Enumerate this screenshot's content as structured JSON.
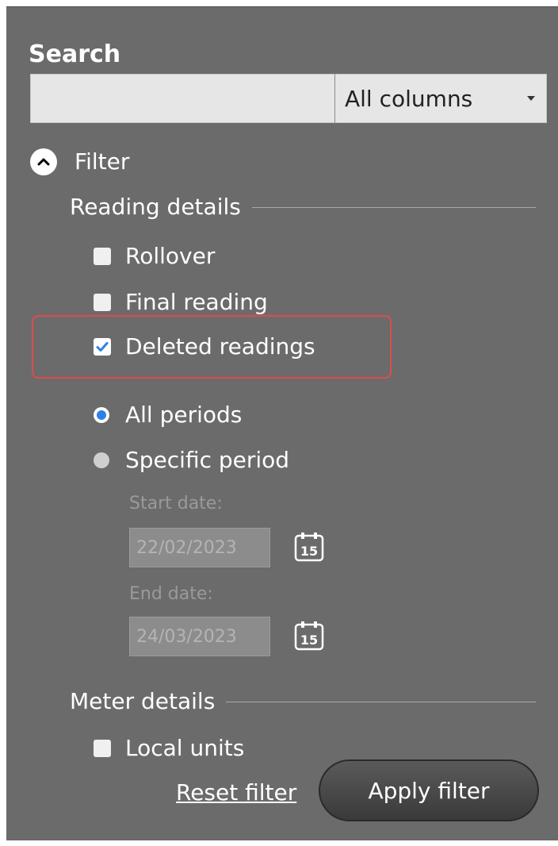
{
  "search": {
    "title": "Search",
    "input_value": "",
    "scope_selected": "All columns"
  },
  "filter": {
    "toggle_label": "Filter",
    "reading_details": {
      "header": "Reading details",
      "checkboxes": [
        {
          "label": "Rollover",
          "checked": false
        },
        {
          "label": "Final reading",
          "checked": false
        },
        {
          "label": "Deleted readings",
          "checked": true
        }
      ],
      "periods": [
        {
          "label": "All periods",
          "selected": true
        },
        {
          "label": "Specific period",
          "selected": false
        }
      ],
      "start_date_label": "Start date:",
      "start_date_value": "22/02/2023",
      "end_date_label": "End date:",
      "end_date_value": "24/03/2023",
      "calendar_day": "15"
    },
    "meter_details": {
      "header": "Meter details",
      "checkboxes": [
        {
          "label": "Local units",
          "checked": false
        }
      ]
    },
    "reset_label": "Reset filter",
    "apply_label": "Apply filter"
  },
  "colors": {
    "panel_bg": "#6b6b6b",
    "highlight_border": "#e04b4b",
    "radio_selected": "#2f7fe8",
    "checkbox_check": "#2f7fe8"
  },
  "icons": {
    "collapse": "chevron-up-circle-icon",
    "calendar": "calendar-icon",
    "dropdown": "caret-down-icon"
  }
}
